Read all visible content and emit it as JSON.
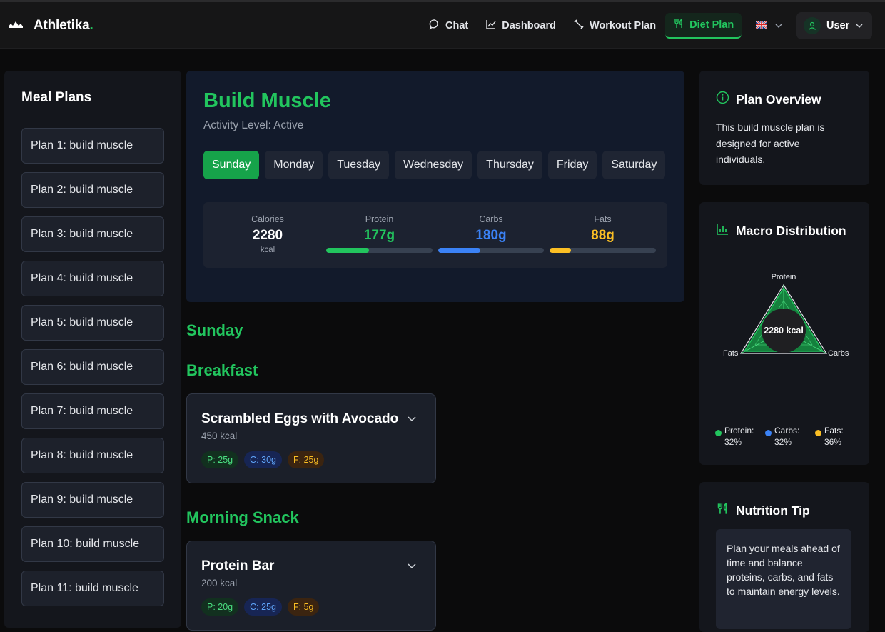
{
  "app": {
    "brand": "Athletika",
    "brand_dot": "."
  },
  "nav": {
    "items": [
      {
        "label": "Chat",
        "icon": "chat-bubble-icon"
      },
      {
        "label": "Dashboard",
        "icon": "line-chart-icon"
      },
      {
        "label": "Workout Plan",
        "icon": "dumbbell-icon"
      },
      {
        "label": "Diet Plan",
        "icon": "utensils-icon",
        "active": true
      }
    ],
    "language_icon": "uk-flag-icon",
    "user_label": "User"
  },
  "sidebar": {
    "title": "Meal Plans",
    "plans": [
      "Plan 1: build muscle",
      "Plan 2: build muscle",
      "Plan 3: build muscle",
      "Plan 4: build muscle",
      "Plan 5: build muscle",
      "Plan 6: build muscle",
      "Plan 7: build muscle",
      "Plan 8: build muscle",
      "Plan 9: build muscle",
      "Plan 10: build muscle",
      "Plan 11: build muscle"
    ]
  },
  "plan": {
    "title": "Build Muscle",
    "activity": "Activity Level: Active",
    "days": [
      "Sunday",
      "Monday",
      "Tuesday",
      "Wednesday",
      "Thursday",
      "Friday",
      "Saturday"
    ],
    "active_day": "Sunday",
    "stats": {
      "calories": {
        "label": "Calories",
        "value": "2280",
        "unit": "kcal"
      },
      "protein": {
        "label": "Protein",
        "value": "177g",
        "fill": 0.4,
        "color": "#22c55e"
      },
      "carbs": {
        "label": "Carbs",
        "value": "180g",
        "fill": 0.4,
        "color": "#3b82f6"
      },
      "fats": {
        "label": "Fats",
        "value": "88g",
        "fill": 0.2,
        "color": "#fbbf24"
      }
    }
  },
  "day_heading": "Sunday",
  "meals": [
    {
      "section": "Breakfast",
      "name": "Scrambled Eggs with Avocado",
      "kcal": "450 kcal",
      "protein": "P: 25g",
      "carbs": "C: 30g",
      "fats": "F: 25g"
    },
    {
      "section": "Morning Snack",
      "name": "Protein Bar",
      "kcal": "200 kcal",
      "protein": "P: 20g",
      "carbs": "C: 25g",
      "fats": "F: 5g"
    }
  ],
  "overview": {
    "title": "Plan Overview",
    "text": "This build muscle plan is designed for active individuals."
  },
  "macro": {
    "title": "Macro Distribution",
    "center_label": "2280 kcal",
    "axis_labels": {
      "top": "Protein",
      "right": "Carbs",
      "left": "Fats"
    },
    "legend": [
      {
        "label": "Protein: 32%",
        "color": "#22c55e"
      },
      {
        "label": "Carbs: 32%",
        "color": "#3b82f6"
      },
      {
        "label": "Fats: 36%",
        "color": "#fbbf24"
      }
    ]
  },
  "tip": {
    "title": "Nutrition Tip",
    "text": "Plan your meals ahead of time and balance proteins, carbs, and fats to maintain energy levels."
  },
  "colors": {
    "accent": "#22c55e",
    "protein": "#22c55e",
    "carbs": "#3b82f6",
    "fats": "#fbbf24"
  }
}
